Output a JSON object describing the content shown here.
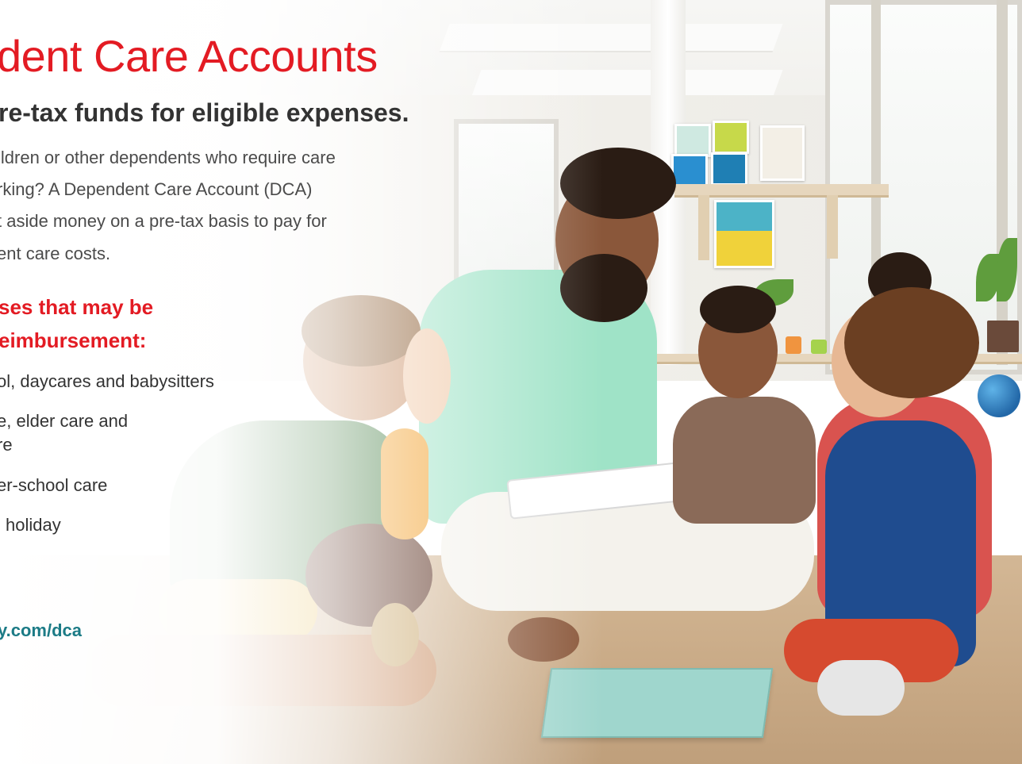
{
  "heading": {
    "title": "dent Care Accounts",
    "subtitle": "re-tax funds for eligible expenses."
  },
  "intro": {
    "lines": [
      "ildren or other dependents who require care",
      "rking? A Dependent Care Account (DCA)",
      "t aside money on a pre-tax basis to pay for",
      "ent care costs."
    ]
  },
  "eligible": {
    "heading_lines": [
      "ses that may be",
      "eimbursement:"
    ],
    "items": [
      "ol, daycares and babysitters",
      "e, elder care and",
      "re",
      "er-school care",
      "l holiday"
    ]
  },
  "footer": {
    "url": "y.com/dca"
  },
  "colors": {
    "accent_red": "#e31b23",
    "link_teal": "#1c7b86",
    "body_text": "#4b4b4b"
  }
}
